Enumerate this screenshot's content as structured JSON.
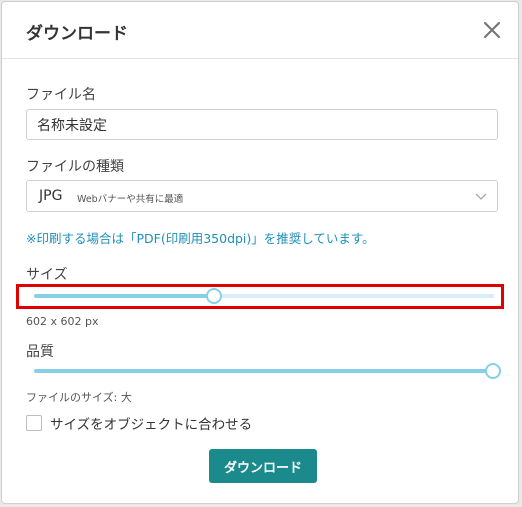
{
  "dialog": {
    "title": "ダウンロード",
    "close_icon": "close-icon"
  },
  "file_name": {
    "label": "ファイル名",
    "value": "名称未設定"
  },
  "file_type": {
    "label": "ファイルの種類",
    "selected": "JPG",
    "selected_desc": "Webバナーや共有に最適"
  },
  "notice": "※印刷する場合は「PDF(印刷用350dpi)」を推奨しています。",
  "size": {
    "label": "サイズ",
    "slider_level": 0.39,
    "readout": "602 x 602 px"
  },
  "quality": {
    "label": "品質",
    "slider_level": 1.0,
    "readout": "ファイルのサイズ: 大"
  },
  "fit_checkbox": {
    "label": "サイズをオブジェクトに合わせる",
    "checked": false
  },
  "download_button": "ダウンロード",
  "colors": {
    "accent": "#1a8a8c",
    "slider": "#86cfe6",
    "notice": "#1e90b8",
    "highlight": "#e00000"
  }
}
